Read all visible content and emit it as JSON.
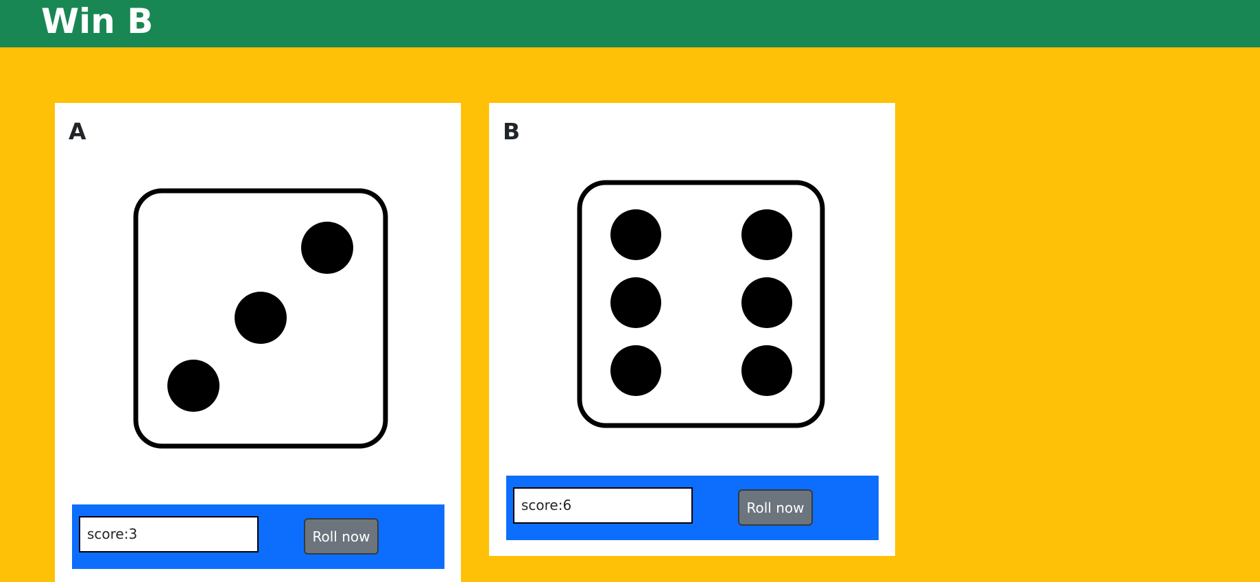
{
  "header": {
    "title": "Win B"
  },
  "players": [
    {
      "name": "A",
      "die_value": 3,
      "score_text": "score:3",
      "roll_label": "Roll now"
    },
    {
      "name": "B",
      "die_value": 6,
      "score_text": "score:6",
      "roll_label": "Roll now"
    }
  ],
  "colors": {
    "header_bg": "#198754",
    "page_bg": "#ffc107",
    "controls_bg": "#0d6efd",
    "button_bg": "#6c757d"
  },
  "icons": [
    "die-three-icon",
    "die-six-icon"
  ]
}
